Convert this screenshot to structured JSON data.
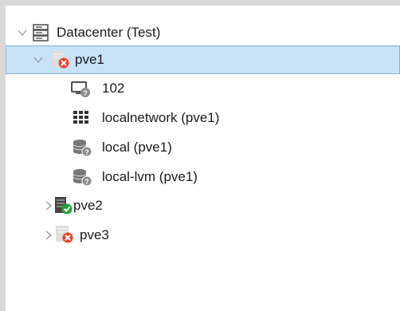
{
  "tree": {
    "datacenter": {
      "label": "Datacenter (Test)",
      "icon": "server-rack-icon"
    },
    "nodes": [
      {
        "label": "pve1",
        "icon": "node-offline-icon",
        "status": "offline",
        "expanded": true,
        "selected": true,
        "children": [
          {
            "label": "102",
            "icon": "vm-unknown-icon"
          },
          {
            "label": "localnetwork (pve1)",
            "icon": "network-grid-icon"
          },
          {
            "label": "local (pve1)",
            "icon": "storage-unknown-icon"
          },
          {
            "label": "local-lvm (pve1)",
            "icon": "storage-unknown-icon"
          }
        ]
      },
      {
        "label": "pve2",
        "icon": "node-online-icon",
        "status": "online",
        "expanded": false
      },
      {
        "label": "pve3",
        "icon": "node-offline-icon",
        "status": "offline",
        "expanded": false
      }
    ]
  },
  "colors": {
    "selection_bg": "#c8e2f8",
    "selection_border": "#7fb2e5",
    "error_red": "#e8452c",
    "ok_green": "#21a336",
    "frame_gray": "#d9d9d9"
  }
}
